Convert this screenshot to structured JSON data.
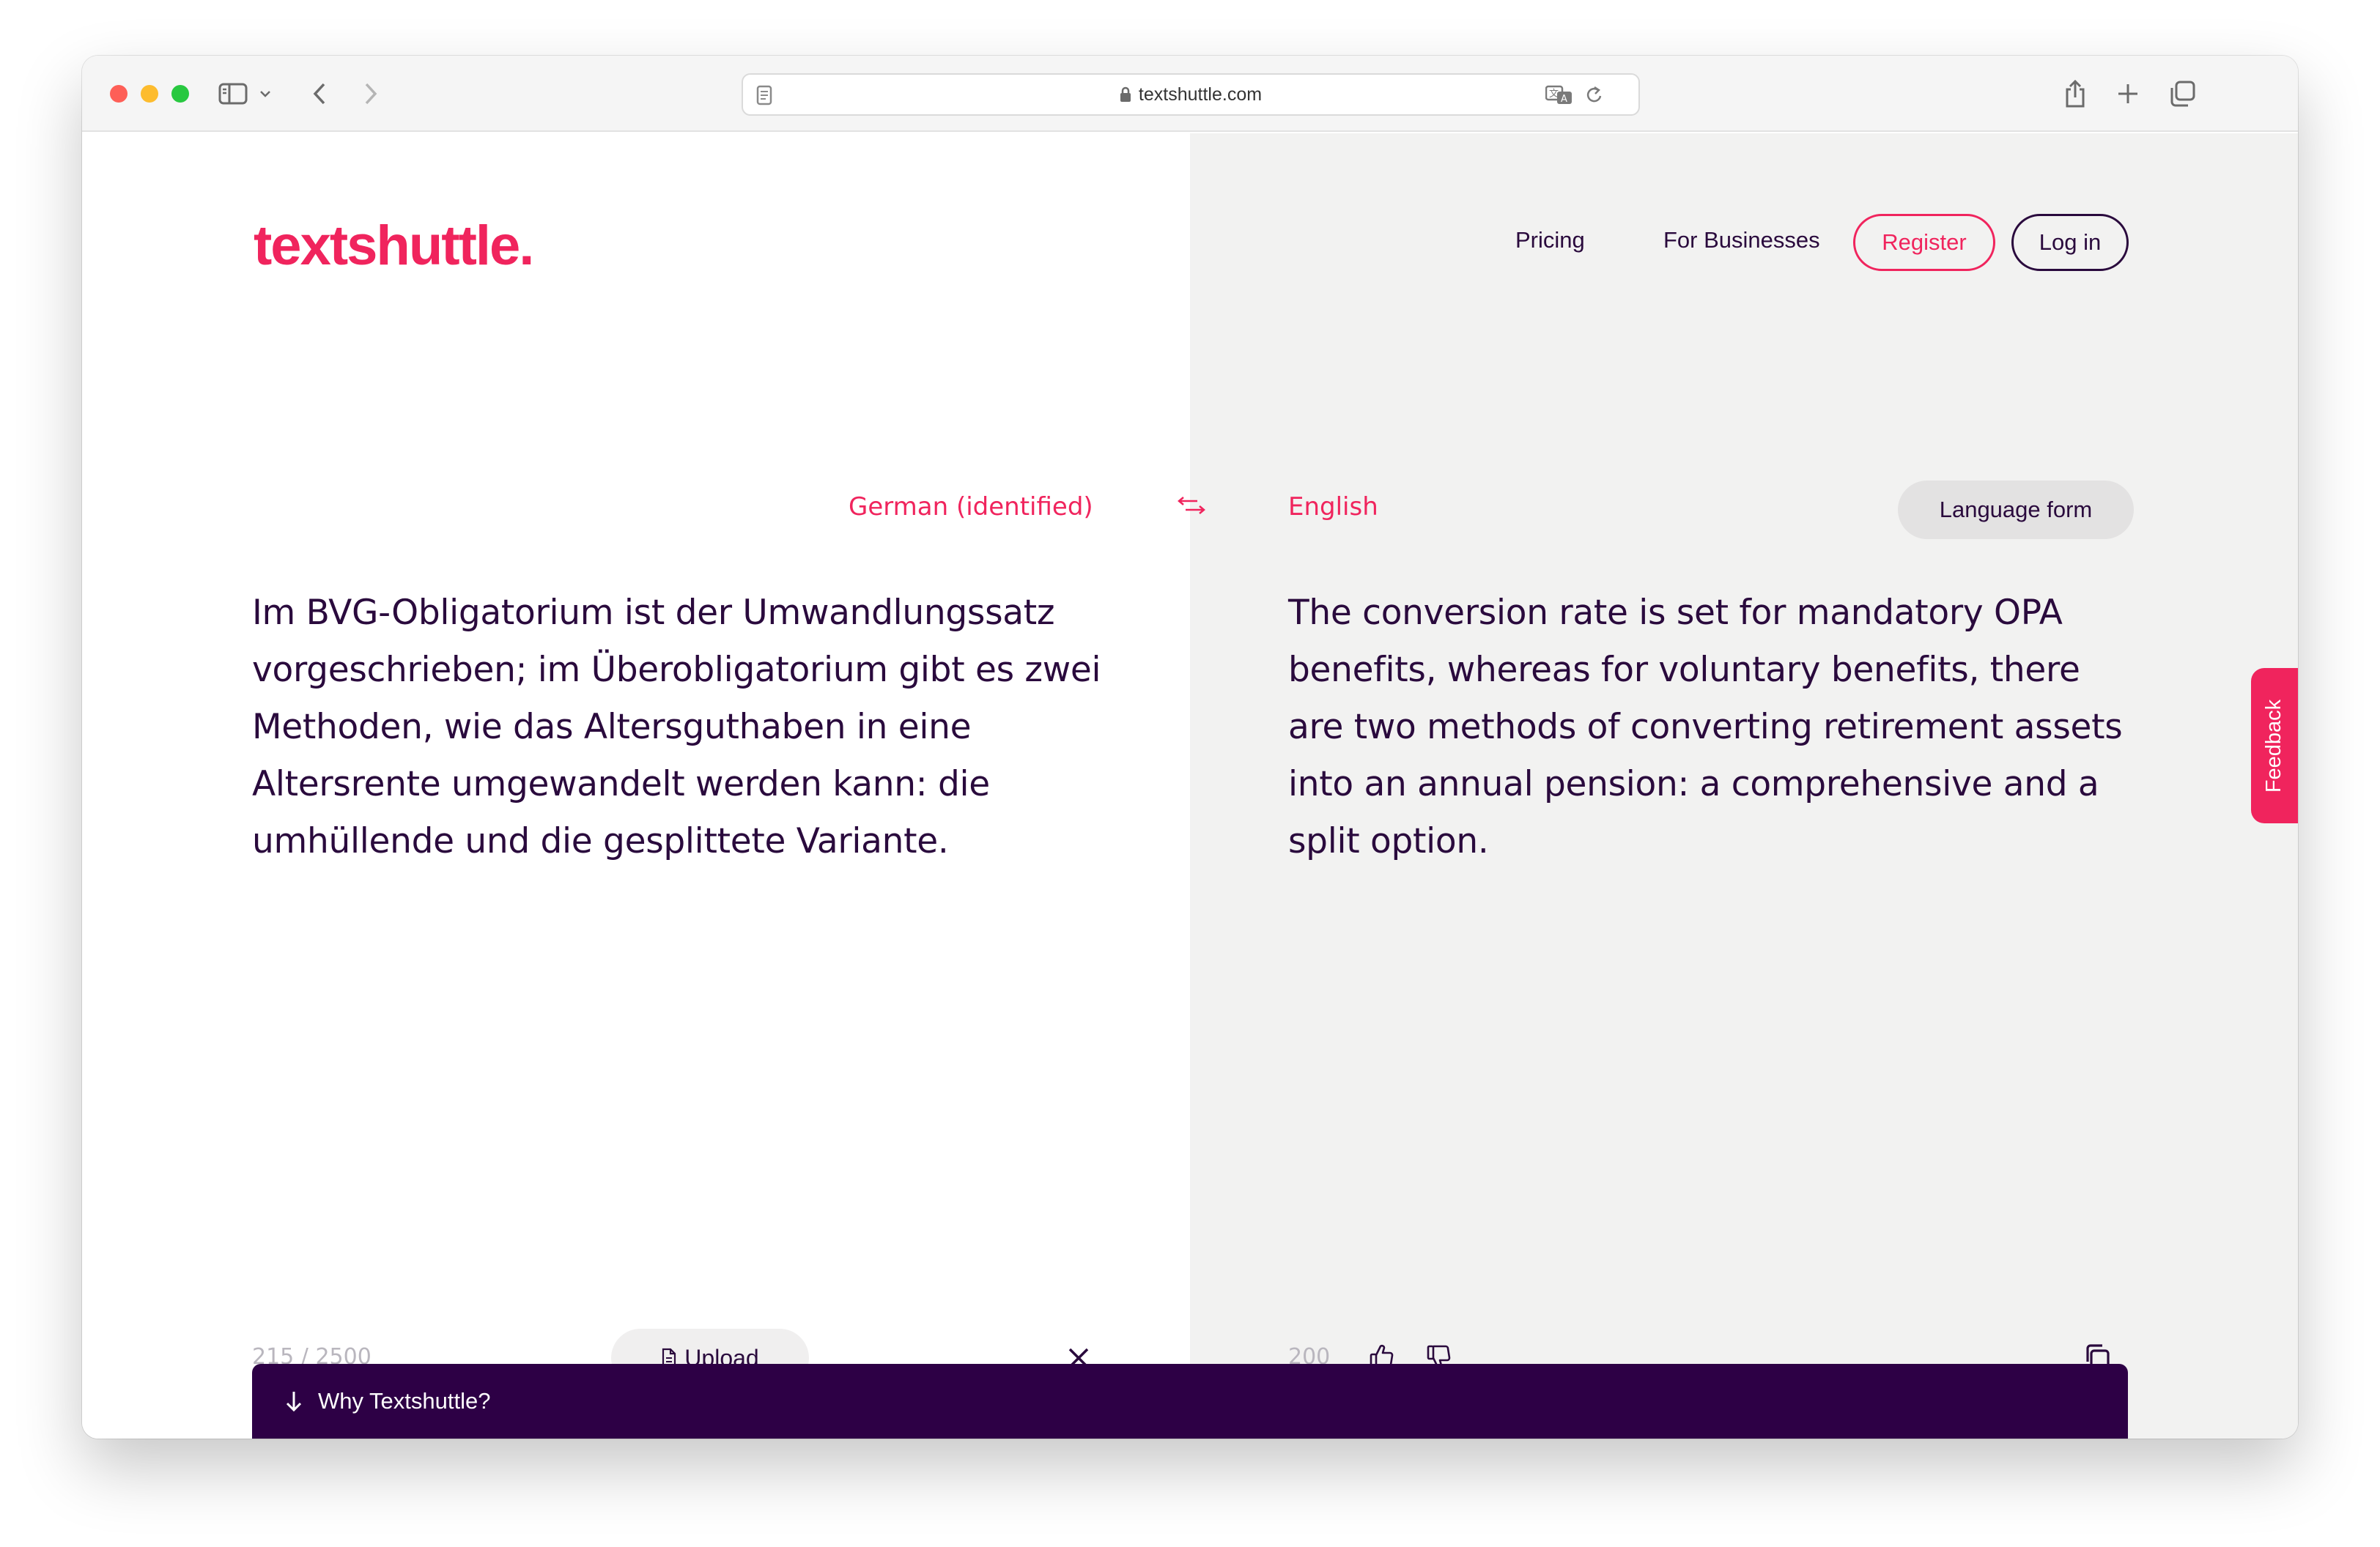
{
  "browser": {
    "url": "textshuttle.com"
  },
  "header": {
    "logo": "textshuttle.",
    "nav": {
      "pricing": "Pricing",
      "for_businesses": "For Businesses",
      "register": "Register",
      "login": "Log in"
    }
  },
  "translator": {
    "source": {
      "language": "German (identified)",
      "text": "Im BVG-Obligatorium ist der Umwandlungssatz vorgeschrieben; im Überobligatorium gibt es zwei Methoden, wie das Altersguthaben in eine Altersrente umgewandelt werden kann: die umhüllende und die gesplittete Variante.",
      "counter": "215 / 2500",
      "upload_label": "Upload"
    },
    "target": {
      "language": "English",
      "language_form_label": "Language form",
      "text": "The conversion rate is set for mandatory OPA benefits, whereas for voluntary benefits, there are two methods of converting retirement assets into an annual pension: a comprehensive and a split option.",
      "counter": "200"
    }
  },
  "footer": {
    "why_label": "Why Textshuttle?"
  },
  "feedback": {
    "label": "Feedback"
  },
  "colors": {
    "brand": "#f0245d",
    "text": "#2a0a3d",
    "bar": "#2d0045",
    "panel": "#f2f2f1"
  },
  "icons": {
    "sidebar": "sidebar-icon",
    "back": "chevron-left-icon",
    "forward": "chevron-right-icon",
    "share": "share-icon",
    "new_tab": "plus-icon",
    "tabs": "tabs-icon",
    "lock": "lock-icon",
    "translate": "translate-icon",
    "reload": "reload-icon",
    "swap": "swap-arrows-icon",
    "document": "document-icon",
    "clear": "close-icon",
    "thumbs_up": "thumbs-up-icon",
    "thumbs_down": "thumbs-down-icon",
    "copy": "copy-icon",
    "arrow_down": "arrow-down-icon"
  }
}
